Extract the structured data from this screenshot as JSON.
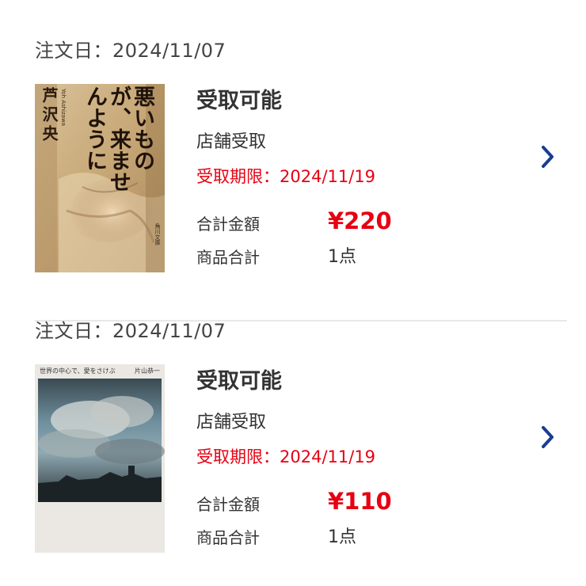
{
  "orders": [
    {
      "date_label": "注文日：2024/11/07",
      "cover": {
        "title": "悪いものが、来ませんように",
        "author": "芦沢央",
        "author_roman": "Yoh Ashizawa",
        "publisher_mark": "角川文庫"
      },
      "status": "受取可能",
      "pickup_method": "店舗受取",
      "deadline_label": "受取期限：2024/11/19",
      "total_label": "合計金額",
      "total_value": "¥220",
      "count_label": "商品合計",
      "count_value": "1点",
      "chevron_icon": "chevron-right-icon"
    },
    {
      "date_label": "注文日：2024/11/07",
      "cover": {
        "title": "世界の中心で、愛をさけぶ",
        "author": "片山恭一"
      },
      "status": "受取可能",
      "pickup_method": "店舗受取",
      "deadline_label": "受取期限：2024/11/19",
      "total_label": "合計金額",
      "total_value": "¥110",
      "count_label": "商品合計",
      "count_value": "1点",
      "chevron_icon": "chevron-right-icon"
    }
  ],
  "colors": {
    "accent_red": "#e60012",
    "chevron_blue": "#1a3d8f",
    "text": "#333333",
    "divider": "#e8e8e8"
  }
}
